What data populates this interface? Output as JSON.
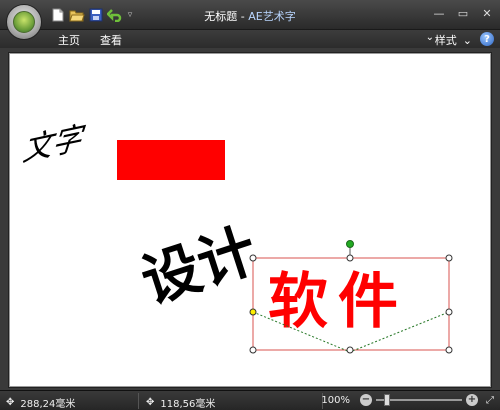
{
  "window": {
    "doc_title": "无标题",
    "title_separator": " - ",
    "app_name": "AE艺术字"
  },
  "quick_access": {
    "icons": [
      "new-file-icon",
      "open-folder-icon",
      "save-icon",
      "undo-icon"
    ]
  },
  "menu": {
    "items": [
      "主页",
      "查看"
    ],
    "style_label": "样式",
    "help_label": "?"
  },
  "canvas": {
    "art_texts": [
      {
        "text": "文字",
        "color": "#000000"
      },
      {
        "text": "设计",
        "color": "#000000"
      },
      {
        "text": "软件",
        "color": "#ff0000"
      }
    ],
    "red_rect_color": "#ff0000",
    "selection_color": "#d9534f",
    "rotate_handle_color": "#22aa22",
    "control_point_color": "#ffee00"
  },
  "status": {
    "coord_x": "288,24毫米",
    "coord_y": "118,56毫米",
    "zoom": "100%"
  }
}
